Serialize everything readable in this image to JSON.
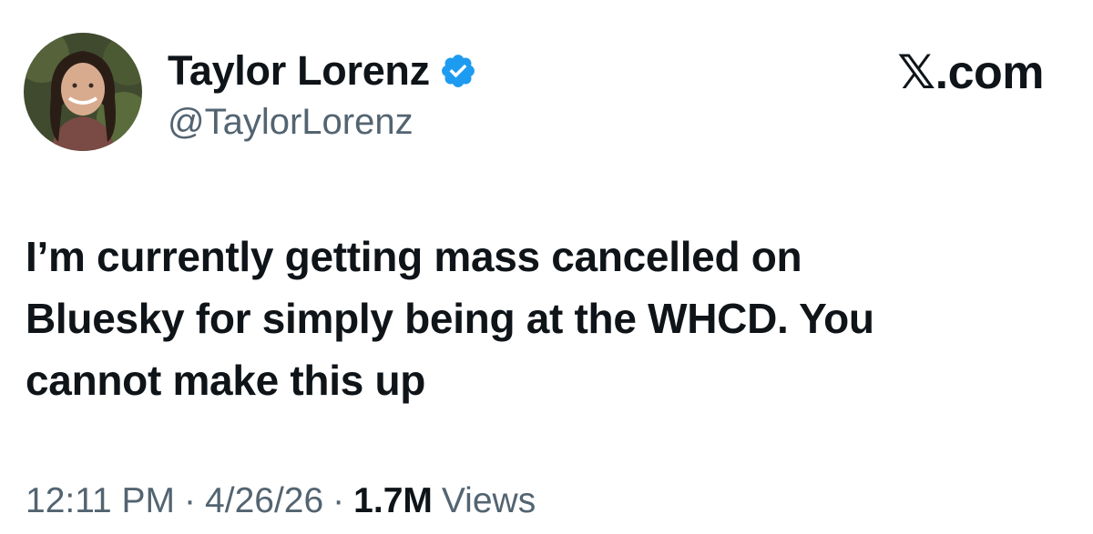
{
  "author": {
    "display_name": "Taylor Lorenz",
    "handle": "@TaylorLorenz",
    "verified": true,
    "verified_color": "#1d9bf0"
  },
  "source_logo": "𝕏.com",
  "tweet": {
    "lines": [
      "I’m currently getting mass cancelled on",
      "Bluesky for simply being at the WHCD. You",
      "cannot make this up"
    ]
  },
  "meta": {
    "time": "12:11 PM",
    "separator": "·",
    "date": "4/26/26",
    "views_count": "1.7M",
    "views_label": "Views"
  },
  "colors": {
    "text_primary": "#0f1419",
    "text_secondary": "#536471"
  }
}
